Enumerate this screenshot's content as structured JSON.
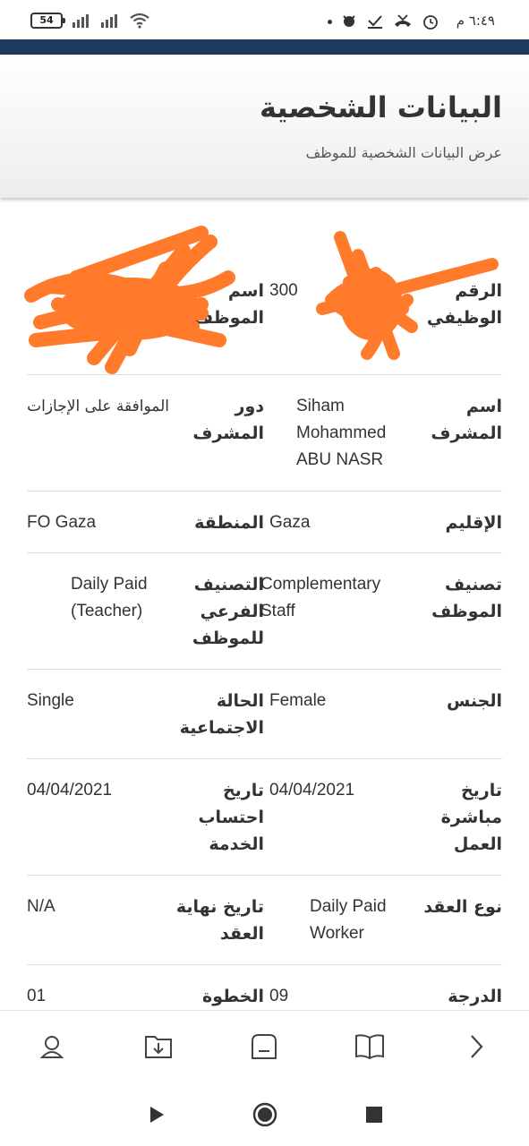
{
  "status_bar": {
    "time": "٦:٤٩ م",
    "battery": "54"
  },
  "header": {
    "title": "البيانات الشخصية",
    "subtitle": "عرض البيانات الشخصية للموظف"
  },
  "fields": [
    {
      "label1": "الرقم الوظيفي",
      "value1": "300",
      "label2": "اسم الموظف",
      "value2": ""
    },
    {
      "label1": "اسم المشرف",
      "value1": "Siham Mohammed ABU NASR",
      "label2": "دور المشرف",
      "value2": "الموافقة على الإجازات"
    },
    {
      "label1": "الإقليم",
      "value1": "Gaza",
      "label2": "المنطقة",
      "value2": "FO Gaza"
    },
    {
      "label1": "تصنيف الموظف",
      "value1": "Complementary Staff",
      "label2": "التصنيف الفرعي للموظف",
      "value2": "Daily Paid (Teacher)"
    },
    {
      "label1": "الجنس",
      "value1": "Female",
      "label2": "الحالة الاجتماعية",
      "value2": "Single"
    },
    {
      "label1": "تاريخ مباشرة العمل",
      "value1": "04/04/2021",
      "label2": "تاريخ احتساب الخدمة",
      "value2": "04/04/2021"
    },
    {
      "label1": "نوع العقد",
      "value1": "Daily Paid Worker",
      "label2": "تاريخ نهاية العقد",
      "value2": "N/A"
    },
    {
      "label1": "الدرجة",
      "value1": "09",
      "label2": "الخطوة",
      "value2": "01"
    }
  ],
  "bottom_nav": [
    "profile-icon",
    "download-folder-icon",
    "minus-box-icon",
    "book-icon",
    "chevron-right-icon"
  ],
  "system_nav": [
    "play-icon",
    "record-icon",
    "stop-icon"
  ]
}
